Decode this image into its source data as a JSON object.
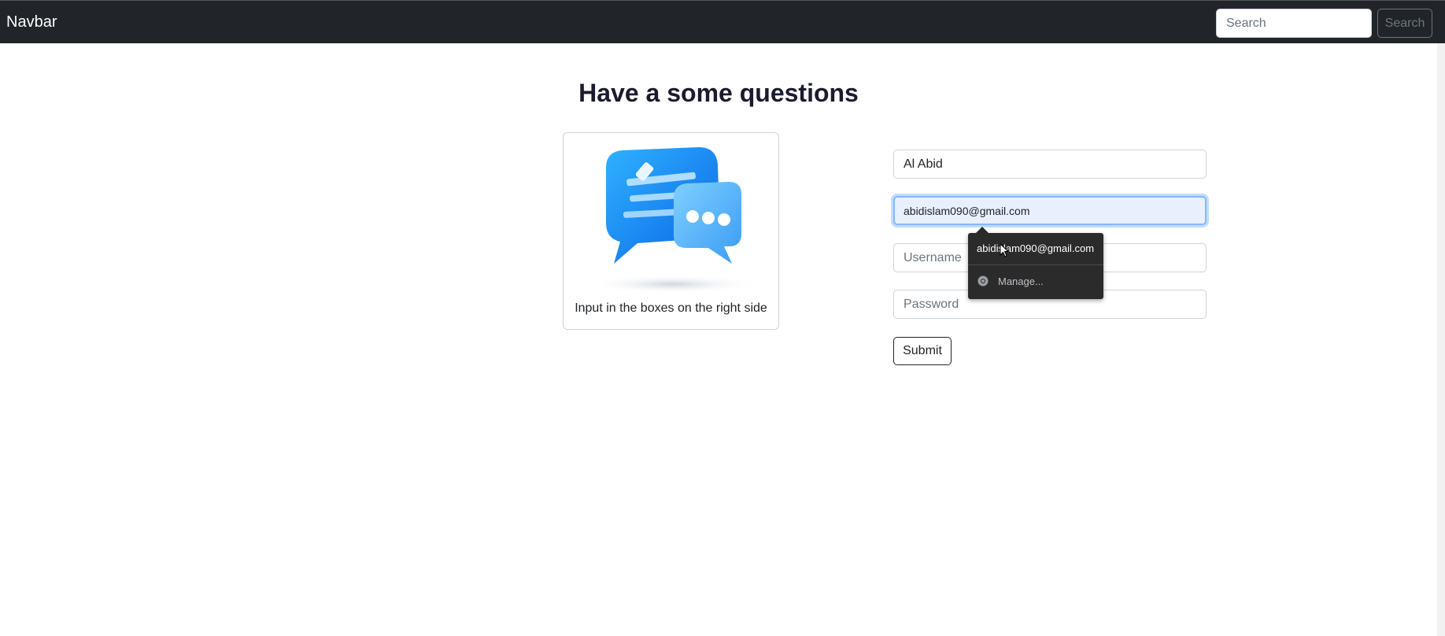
{
  "navbar": {
    "brand": "Navbar",
    "search_placeholder": "Search",
    "search_button": "Search"
  },
  "page": {
    "title": "Have a some questions"
  },
  "card": {
    "illustration_icon": "chat-bubbles-icon",
    "caption": "Input in the boxes on the right side"
  },
  "form": {
    "name_value": "Al Abid",
    "email_value": "abidislam090@gmail.com",
    "username_placeholder": "Username",
    "password_placeholder": "Password",
    "submit_label": "Submit"
  },
  "autofill": {
    "suggestion": "abidislam090@gmail.com",
    "manage_label": "Manage...",
    "icon": "chrome-icon"
  },
  "colors": {
    "navbar_bg": "#212529",
    "accent_blue": "#1a8cff",
    "autofill_field_bg": "#e8f0fe"
  }
}
